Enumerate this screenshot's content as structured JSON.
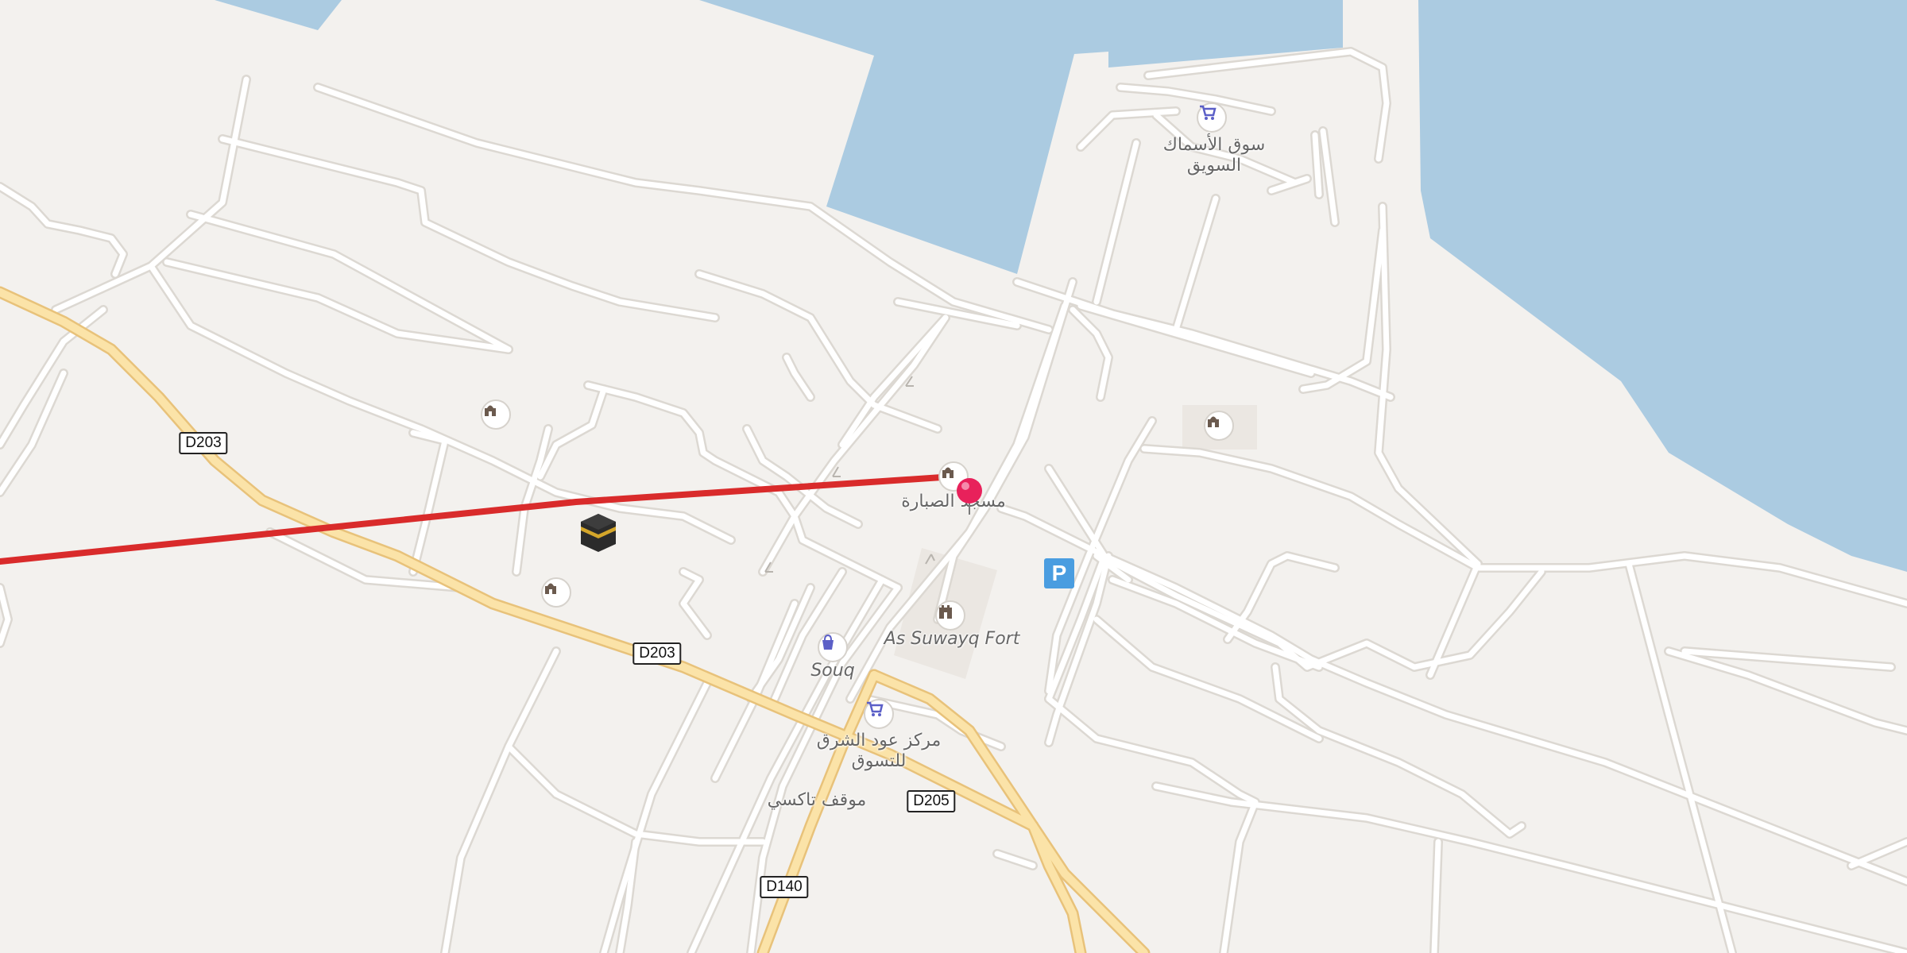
{
  "map": {
    "colors": {
      "land": "#f3f1ee",
      "water": "#abcbe1",
      "road_major_fill": "#fbe3a8",
      "road_major_casing": "#e8c27a",
      "road_minor": "#ffffff",
      "road_minor_casing": "#dcd8d2",
      "route_line": "#d92b2b",
      "pin": "#e8215b",
      "poi_icon": "#6b5a4e",
      "shop_icon": "#5b5fc7",
      "parking": "#4a9de0"
    },
    "road_shields": [
      {
        "id": "d203-west",
        "label": "D203"
      },
      {
        "id": "d203-center",
        "label": "D203"
      },
      {
        "id": "d205",
        "label": "D205"
      },
      {
        "id": "d140",
        "label": "D140"
      }
    ],
    "labels": {
      "fish_market_line1": "سوق الأسماك",
      "fish_market_line2": "السويق",
      "mosque_sabara": "مسجد الصبارة",
      "fort": "As Suwayq Fort",
      "souq": "Souq",
      "center_line1": "مركز عود الشرق",
      "center_line2": "للتسوق",
      "taxi": "موقف تاكسي"
    },
    "icons": {
      "mosque": "mosque-icon",
      "shop": "shopping-cart-icon",
      "fort": "castle-icon",
      "souq": "shopping-bag-icon",
      "kaaba": "kaaba-icon",
      "pin": "map-pin-icon",
      "parking": "P"
    }
  }
}
